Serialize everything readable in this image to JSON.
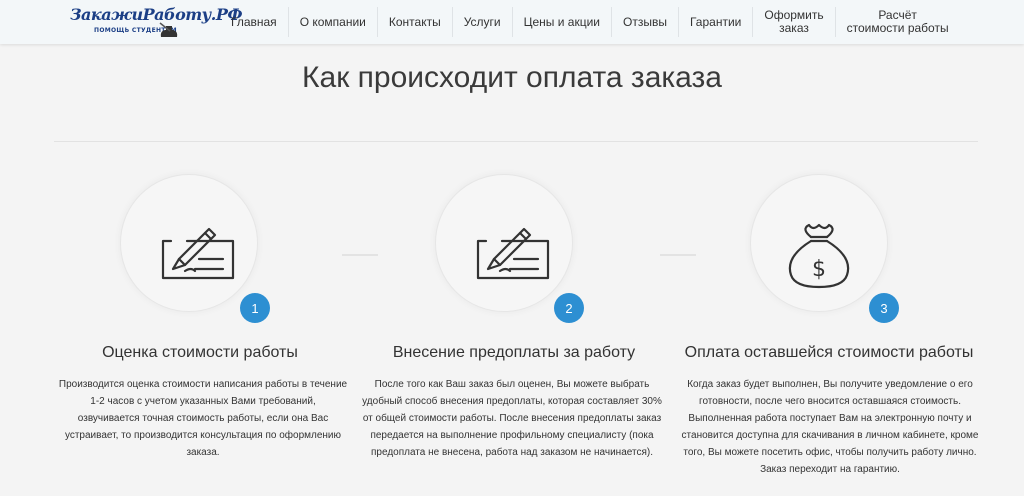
{
  "header": {
    "logo": {
      "text": "ЗакажиРаботу.РФ",
      "tagline": "ПОМОЩЬ СТУДЕНТАМ"
    },
    "nav": [
      {
        "label": "Главная"
      },
      {
        "label": "О компании"
      },
      {
        "label": "Контакты"
      },
      {
        "label": "Услуги"
      },
      {
        "label": "Цены и акции"
      },
      {
        "label": "Отзывы"
      },
      {
        "label": "Гарантии"
      },
      {
        "label": "Оформить\nзаказ"
      },
      {
        "label": "Расчёт\nстоимости работы"
      }
    ]
  },
  "main": {
    "title": "Как происходит оплата заказа",
    "steps": [
      {
        "number": "1",
        "icon": "signed-document-icon",
        "title": "Оценка стоимости работы",
        "text": "Производится оценка стоимости написания работы в течение 1-2 часов с учетом указанных Вами требований, озвучивается точная стоимость работы, если она Вас устраивает, то производится консультация по оформлению заказа."
      },
      {
        "number": "2",
        "icon": "signed-document-icon",
        "title": "Внесение предоплаты за работу",
        "text": "После того как Ваш заказ был оценен, Вы можете выбрать удобный способ внесения предоплаты, которая составляет 30% от общей стоимости работы. После внесения предоплаты заказ передается на выполнение профильному специалисту (пока предоплата не внесена, работа над заказом не начинается)."
      },
      {
        "number": "3",
        "icon": "money-bag-icon",
        "title": "Оплата оставшейся стоимости работы",
        "text": "Когда заказ будет выполнен, Вы получите уведомление о его готовности, после чего вносится оставшаяся стоимость. Выполненная работа поступает Вам на электронную почту и становится доступна для скачивания в личном кабинете, кроме того, Вы можете посетить офис, чтобы получить работу лично. Заказ переходит на гарантию."
      }
    ]
  },
  "colors": {
    "accent": "#2d8fd2",
    "logo": "#1c3f86",
    "background": "#f4f4f4"
  }
}
